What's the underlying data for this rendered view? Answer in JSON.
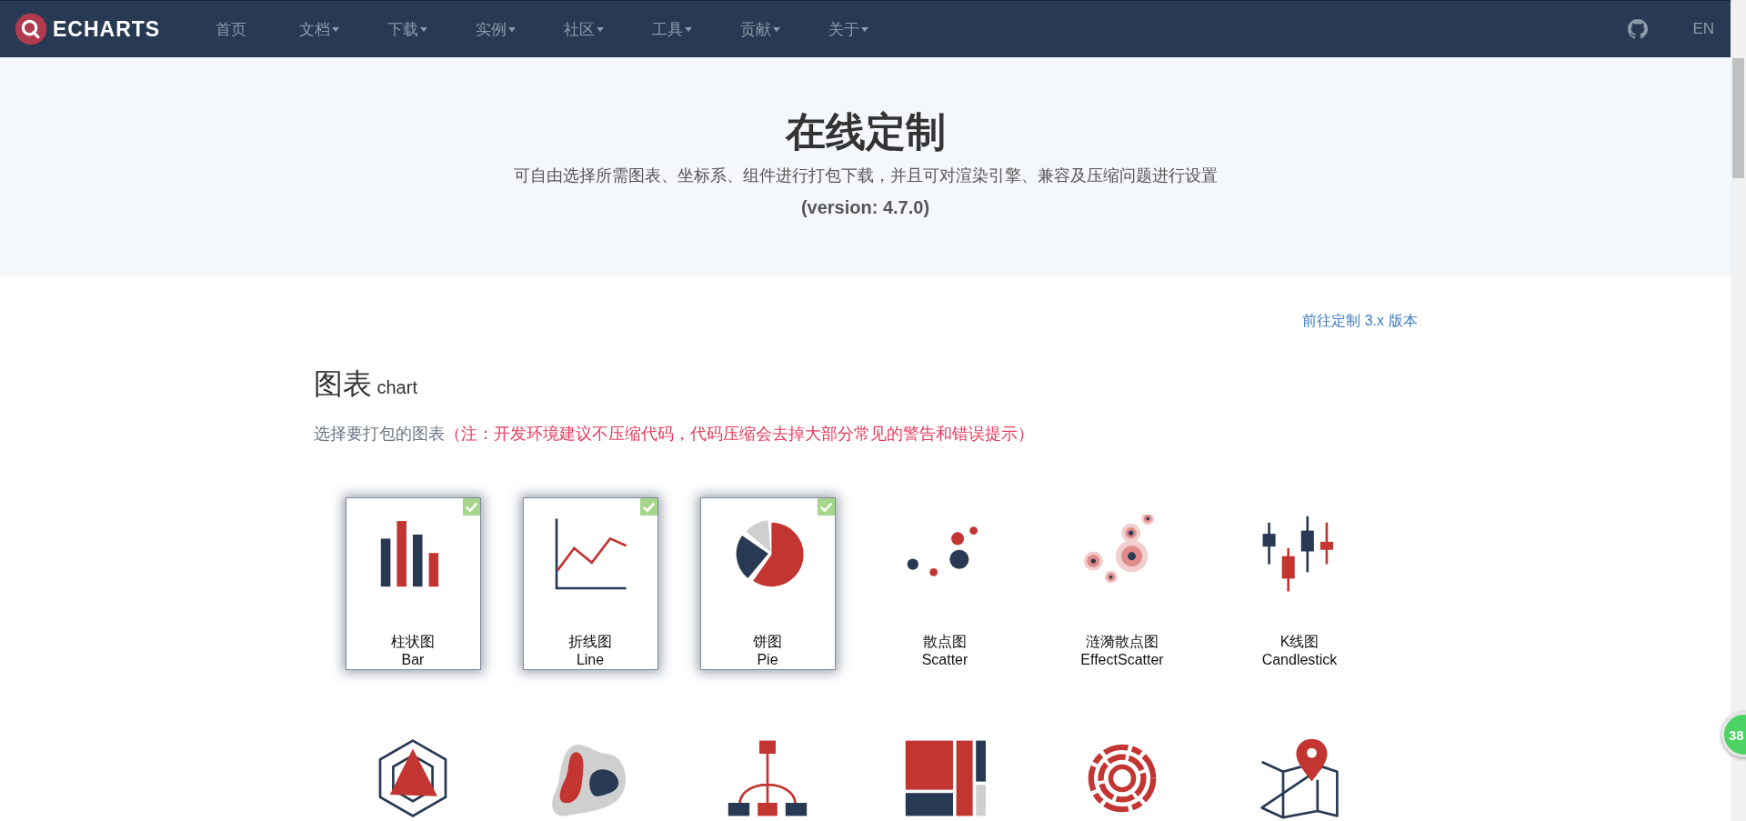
{
  "nav": {
    "logo": "ECHARTS",
    "items": [
      {
        "label": "首页",
        "has_menu": false
      },
      {
        "label": "文档",
        "has_menu": true
      },
      {
        "label": "下载",
        "has_menu": true
      },
      {
        "label": "实例",
        "has_menu": true
      },
      {
        "label": "社区",
        "has_menu": true
      },
      {
        "label": "工具",
        "has_menu": true
      },
      {
        "label": "贡献",
        "has_menu": true
      },
      {
        "label": "关于",
        "has_menu": true
      }
    ],
    "language": "EN"
  },
  "header": {
    "title": "在线定制",
    "subtitle": "可自由选择所需图表、坐标系、组件进行打包下载，并且可对渲染引擎、兼容及压缩问题进行设置",
    "version": "(version: 4.7.0)"
  },
  "legacy_link": "前往定制 3.x 版本",
  "section": {
    "title": "图表",
    "title_en": "chart",
    "hint": "选择要打包的图表",
    "warning": "（注：开发环境建议不压缩代码，代码压缩会去掉大部分常见的警告和错误提示）"
  },
  "charts": [
    {
      "kind": "bar",
      "name": "柱状图",
      "name_en": "Bar",
      "selected": true
    },
    {
      "kind": "line",
      "name": "折线图",
      "name_en": "Line",
      "selected": true
    },
    {
      "kind": "pie",
      "name": "饼图",
      "name_en": "Pie",
      "selected": true
    },
    {
      "kind": "scatter",
      "name": "散点图",
      "name_en": "Scatter",
      "selected": false
    },
    {
      "kind": "effect-scatter",
      "name": "涟漪散点图",
      "name_en": "EffectScatter",
      "selected": false
    },
    {
      "kind": "candlestick",
      "name": "K线图",
      "name_en": "Candlestick",
      "selected": false
    },
    {
      "kind": "radar",
      "selected": false
    },
    {
      "kind": "blob",
      "selected": false
    },
    {
      "kind": "tree",
      "selected": false
    },
    {
      "kind": "treemap",
      "selected": false
    },
    {
      "kind": "sunburst",
      "selected": false
    },
    {
      "kind": "map",
      "selected": false
    }
  ],
  "float_badge": "38"
}
